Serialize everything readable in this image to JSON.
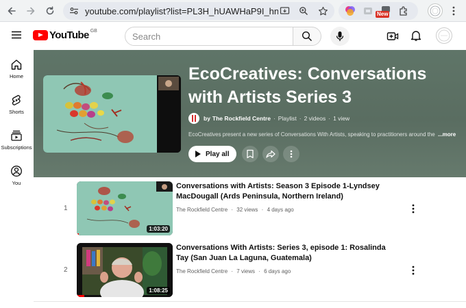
{
  "browser": {
    "url": "youtube.com/playlist?list=PL3H_hUAWHaP9I_hnOrJ...",
    "extension_badge": "New"
  },
  "header": {
    "logo_text": "YouTube",
    "country_code": "GB",
    "search_placeholder": "Search"
  },
  "sidebar": {
    "items": [
      {
        "label": "Home",
        "icon": "home-icon"
      },
      {
        "label": "Shorts",
        "icon": "shorts-icon"
      },
      {
        "label": "Subscriptions",
        "icon": "subscriptions-icon"
      },
      {
        "label": "You",
        "icon": "you-icon"
      }
    ]
  },
  "playlist": {
    "title": "EcoCreatives: Conversations with Artists Series 3",
    "owner_prefix": "by",
    "owner": "The Rockfield Centre",
    "type": "Playlist",
    "video_count": "2 videos",
    "view_count": "1 view",
    "separator": "·",
    "description": "EcoCreatives present a new series of Conversations With Artists, speaking to practitioners around the world",
    "more_label": "...more",
    "play_all_label": "Play all"
  },
  "videos": [
    {
      "index": "1",
      "title": "Conversations with Artists: Season 3 Episode 1-Lyndsey MacDougall (Ards Peninsula, Northern Ireland)",
      "channel": "The Rockfield Centre",
      "views": "32 views",
      "age": "4 days ago",
      "duration": "1:03:20",
      "watched_fraction": 0.02
    },
    {
      "index": "2",
      "title": "Conversations With Artists: Series 3, episode 1: Rosalinda Tay (San Juan La Laguna, Guatemala)",
      "channel": "The Rockfield Centre",
      "views": "7 views",
      "age": "6 days ago",
      "duration": "1:08:25",
      "watched_fraction": 0.08
    }
  ],
  "colors": {
    "brand": "#ff0000",
    "hero_bg": "#5f7568",
    "text_primary": "#0f0f0f",
    "text_secondary": "#606060"
  }
}
